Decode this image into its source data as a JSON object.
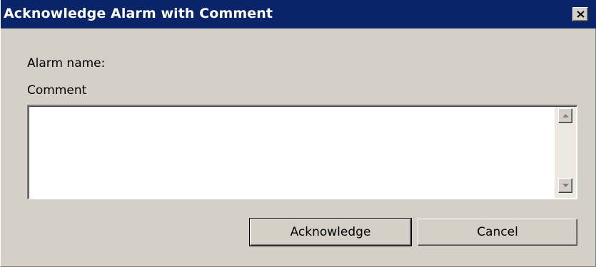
{
  "window": {
    "title": "Acknowledge Alarm with Comment",
    "close_icon": "close-x-icon"
  },
  "form": {
    "alarm_name_label": "Alarm name:",
    "alarm_name_value": "",
    "comment_label": "Comment",
    "comment_value": ""
  },
  "scrollbar": {
    "up_icon": "arrow-up-icon",
    "down_icon": "arrow-down-icon"
  },
  "buttons": {
    "acknowledge_label": "Acknowledge",
    "cancel_label": "Cancel"
  },
  "colors": {
    "titlebar": "#0a246a",
    "face": "#d4d0c8",
    "title_text": "#ffffff"
  }
}
